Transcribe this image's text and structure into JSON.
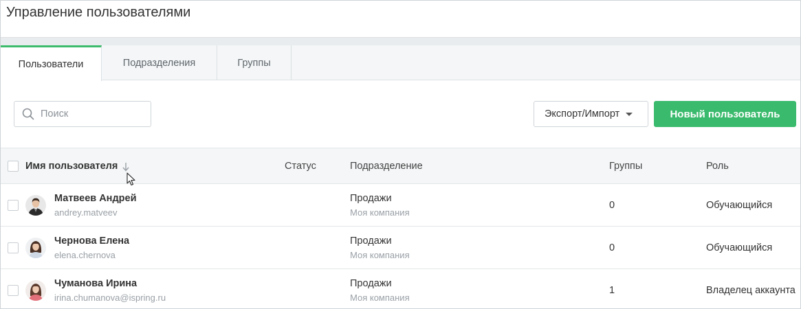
{
  "page": {
    "title": "Управление пользователями"
  },
  "tabs": [
    {
      "label": "Пользователи",
      "active": true
    },
    {
      "label": "Подразделения",
      "active": false
    },
    {
      "label": "Группы",
      "active": false
    }
  ],
  "toolbar": {
    "search_placeholder": "Поиск",
    "search_value": "",
    "export_label": "Экспорт/Импорт",
    "new_user_label": "Новый пользователь"
  },
  "table": {
    "columns": {
      "name": "Имя пользователя",
      "status": "Статус",
      "department": "Подразделение",
      "groups": "Группы",
      "role": "Роль"
    },
    "sort_icon": "arrow-down-icon",
    "rows": [
      {
        "name": "Матвеев Андрей",
        "login": "andrey.matveev",
        "status": "",
        "department": "Продажи",
        "company": "Моя компания",
        "groups": "0",
        "role": "Обучающийся",
        "avatar": "male-avatar"
      },
      {
        "name": "Чернова Елена",
        "login": "elena.chernova",
        "status": "",
        "department": "Продажи",
        "company": "Моя компания",
        "groups": "0",
        "role": "Обучающийся",
        "avatar": "female-avatar"
      },
      {
        "name": "Чуманова Ирина",
        "login": "irina.chumanova@ispring.ru",
        "status": "",
        "department": "Продажи",
        "company": "Моя компания",
        "groups": "1",
        "role": "Владелец аккаунта",
        "avatar": "female-avatar"
      }
    ]
  },
  "colors": {
    "accent": "#3aba6c",
    "tab_indicator": "#3dbb6c",
    "header_bg": "#f4f6f7"
  }
}
